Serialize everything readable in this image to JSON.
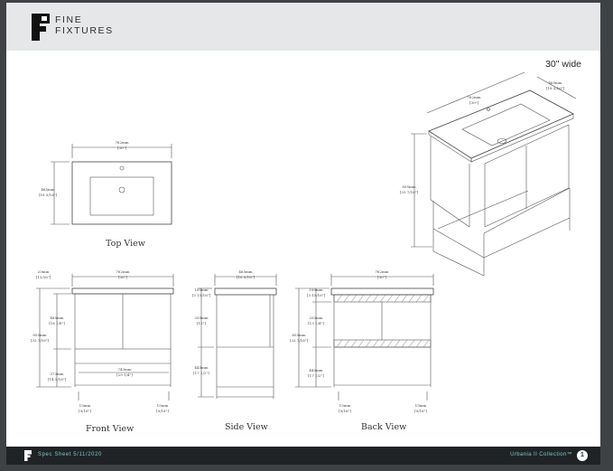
{
  "header": {
    "brand_line1": "FINE",
    "brand_line2": "FIXTURES"
  },
  "subtitle": "30\" wide",
  "top_view": {
    "label": "Top View",
    "width_mm": "762mm",
    "width_in": "[30\"]",
    "depth_mm": "465mm",
    "depth_in": "[18 5/16\"]"
  },
  "iso_view": {
    "width_mm": "762mm",
    "width_in": "[30\"]",
    "depth_mm": "465mm",
    "depth_in": "[18 5/16\"]",
    "height_mm": "855mm",
    "height_in": "[33 7/16\"]"
  },
  "front_view": {
    "label": "Front View",
    "top_mm": "20mm",
    "top_in": "[13/16\"]",
    "width_mm": "762mm",
    "width_in": "[30\"]",
    "doors_mm": "485mm",
    "doors_in": "[18 1/8\"]",
    "total_mm": "855mm",
    "total_in": "[33 7/16\"]",
    "shelf_mm": "373mm",
    "shelf_in": "[14 5/16\"]",
    "inner_mm": "743mm",
    "inner_in": "[29 1/4\"]",
    "foot_l_mm": "15mm",
    "foot_l_in": "[9/16\"]",
    "foot_r_mm": "15mm",
    "foot_r_in": "[9/16\"]"
  },
  "side_view": {
    "label": "Side View",
    "depth_mm": "465mm",
    "depth_in": "[18 5/16\"]",
    "top_mm": "100mm",
    "top_in": "[3 15/16\"]",
    "mid_mm": "335mm",
    "mid_in": "[12\"]",
    "low_mm": "445mm",
    "low_in": "[17 1/2\"]"
  },
  "back_view": {
    "label": "Back View",
    "width_mm": "762mm",
    "width_in": "[30\"]",
    "top_mm": "100mm",
    "top_in": "[3 15/16\"]",
    "mid_mm": "335mm",
    "mid_in": "[13 1/4\"]",
    "total_mm": "855mm",
    "total_in": "[33 7/16\"]",
    "low_mm": "445mm",
    "low_in": "[17 1/2\"]",
    "foot_l_mm": "15mm",
    "foot_l_in": "[9/16\"]",
    "foot_r_mm": "15mm",
    "foot_r_in": "[9/16\"]"
  },
  "footer": {
    "left": "Spec Sheet 5/11/2020",
    "right": "Urbania II Collection™",
    "page": "1"
  },
  "colors": {
    "footer_bg": "#1f2326",
    "footer_text": "#7fc4c7",
    "header_bg": "#e6e7e8"
  }
}
